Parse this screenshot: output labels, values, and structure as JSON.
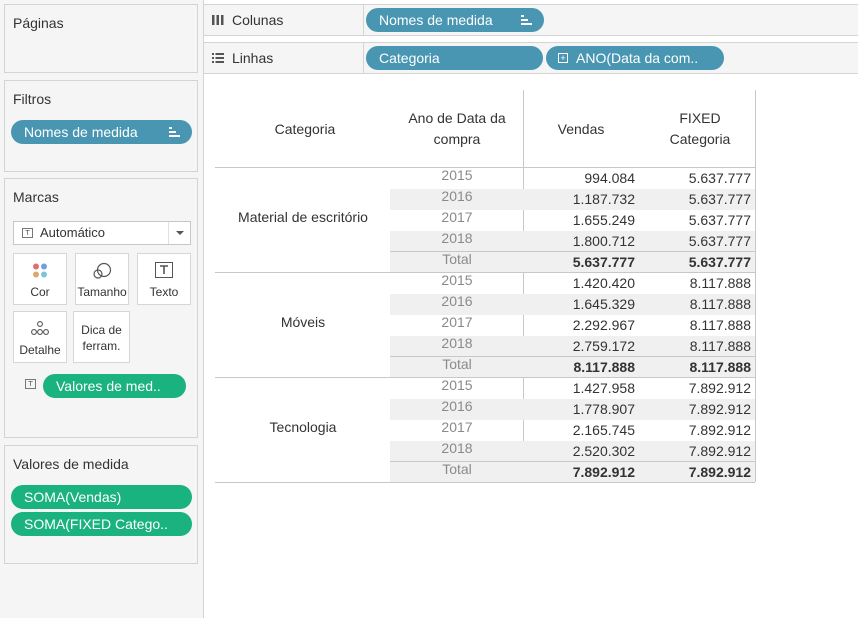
{
  "left": {
    "pages_title": "Páginas",
    "filters_title": "Filtros",
    "filter_pill": "Nomes de medida",
    "marks_title": "Marcas",
    "mark_type": "Automático",
    "mark_buttons": [
      "Cor",
      "Tamanho",
      "Texto",
      "Detalhe"
    ],
    "tooltip_label": "Dica de ferram.",
    "marks_pill": "Valores de med..",
    "measure_values_title": "Valores de medida",
    "measure_pills": [
      "SOMA(Vendas)",
      "SOMA(FIXED Catego.."
    ]
  },
  "shelves": {
    "columns_label": "Colunas",
    "columns_pill": "Nomes de medida",
    "rows_label": "Linhas",
    "rows_pills": [
      "Categoria",
      "ANO(Data da com.."
    ]
  },
  "table": {
    "headers": {
      "category": "Categoria",
      "year_line1": "Ano de Data da",
      "year_line2": "compra",
      "sales": "Vendas",
      "fixed_line1": "FIXED",
      "fixed_line2": "Categoria"
    },
    "groups": [
      {
        "name": "Material de escritório",
        "rows": [
          {
            "year": "2015",
            "sales": "994.084",
            "fixed": "5.637.777"
          },
          {
            "year": "2016",
            "sales": "1.187.732",
            "fixed": "5.637.777"
          },
          {
            "year": "2017",
            "sales": "1.655.249",
            "fixed": "5.637.777"
          },
          {
            "year": "2018",
            "sales": "1.800.712",
            "fixed": "5.637.777"
          },
          {
            "year": "Total",
            "sales": "5.637.777",
            "fixed": "5.637.777"
          }
        ]
      },
      {
        "name": "Móveis",
        "rows": [
          {
            "year": "2015",
            "sales": "1.420.420",
            "fixed": "8.117.888"
          },
          {
            "year": "2016",
            "sales": "1.645.329",
            "fixed": "8.117.888"
          },
          {
            "year": "2017",
            "sales": "2.292.967",
            "fixed": "8.117.888"
          },
          {
            "year": "2018",
            "sales": "2.759.172",
            "fixed": "8.117.888"
          },
          {
            "year": "Total",
            "sales": "8.117.888",
            "fixed": "8.117.888"
          }
        ]
      },
      {
        "name": "Tecnologia",
        "rows": [
          {
            "year": "2015",
            "sales": "1.427.958",
            "fixed": "7.892.912"
          },
          {
            "year": "2016",
            "sales": "1.778.907",
            "fixed": "7.892.912"
          },
          {
            "year": "2017",
            "sales": "2.165.745",
            "fixed": "7.892.912"
          },
          {
            "year": "2018",
            "sales": "2.520.302",
            "fixed": "7.892.912"
          },
          {
            "year": "Total",
            "sales": "7.892.912",
            "fixed": "7.892.912"
          }
        ]
      }
    ]
  },
  "colors": {
    "dimension_pill": "#4996b2",
    "measure_pill": "#1ab27f",
    "band": "#f0f0f0"
  }
}
